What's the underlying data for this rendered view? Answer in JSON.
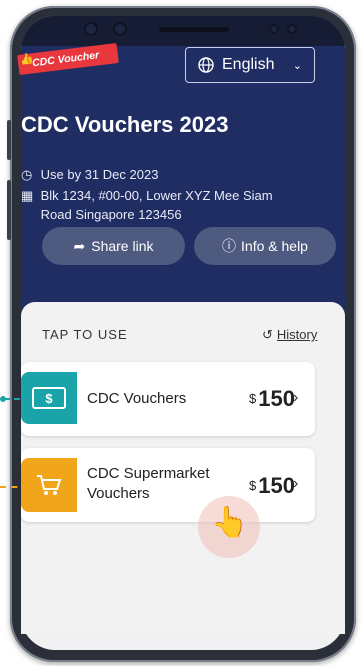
{
  "app": {
    "logo_text": "CDC Voucher",
    "language_label": "English",
    "title": "CDC Vouchers 2023",
    "use_by": "Use by 31 Dec 2023",
    "address_line1": "Blk 1234, #00-00, Lower XYZ Mee Siam",
    "address_line2": "Road Singapore 123456",
    "share_label": "Share link",
    "info_label": "Info & help"
  },
  "vouchers": {
    "section_label": "TAP TO USE",
    "history_label": "History",
    "items": [
      {
        "name": "CDC Vouchers",
        "currency": "$",
        "amount": "150",
        "color": "#1aa3a8",
        "icon": "voucher-icon"
      },
      {
        "name_line1": "CDC Supermarket",
        "name_line2": "Vouchers",
        "currency": "$",
        "amount": "150",
        "color": "#f0a51b",
        "icon": "shopping-cart-icon"
      }
    ]
  },
  "colors": {
    "header": "#1f2d63",
    "accent_teal": "#1aa3a8",
    "accent_orange": "#f0a51b"
  }
}
